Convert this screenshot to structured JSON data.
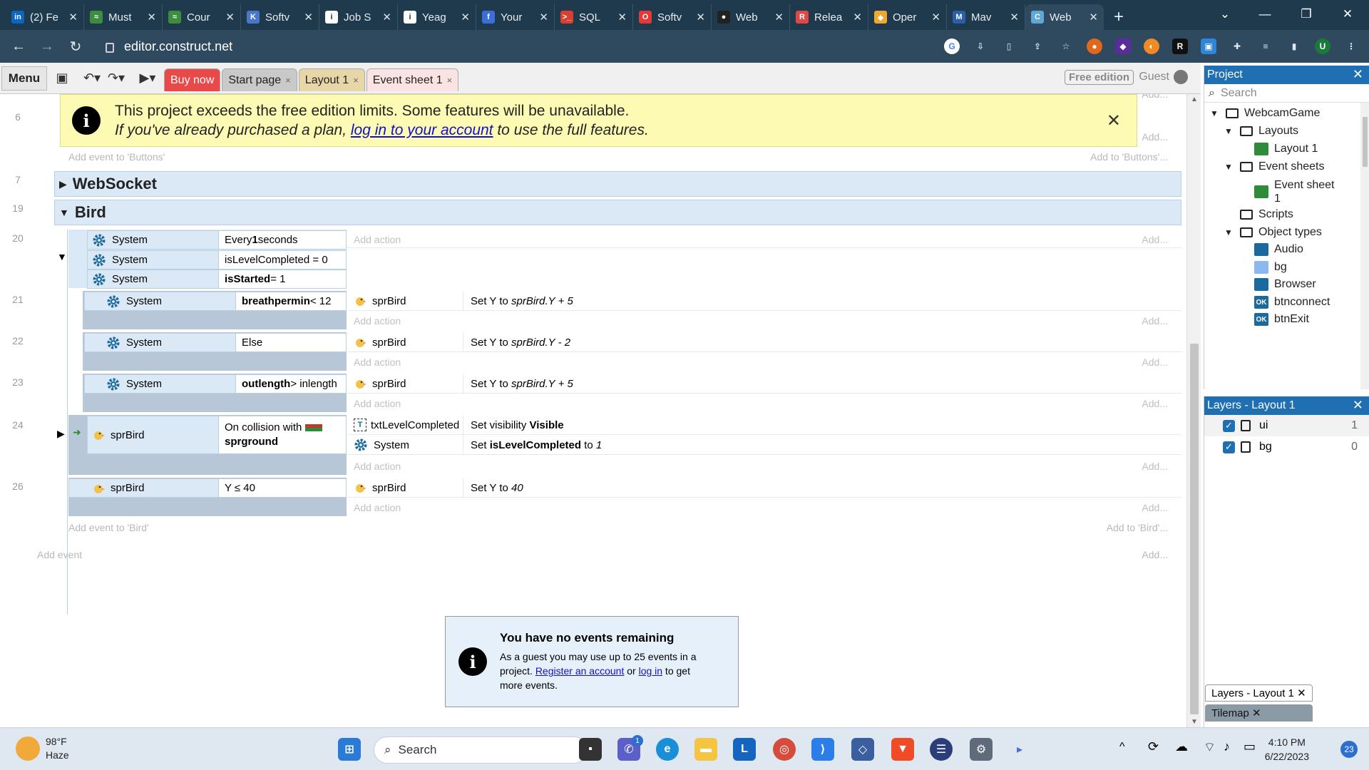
{
  "browser": {
    "tabs": [
      {
        "label": "(2) Fe",
        "icon": "linkedin-icon",
        "color": "#0a66c2",
        "glyph": "in"
      },
      {
        "label": "Must",
        "icon": "mustache-icon",
        "color": "#3c8d40",
        "glyph": "≈"
      },
      {
        "label": "Cour",
        "icon": "mustache-icon",
        "color": "#3c8d40",
        "glyph": "≈"
      },
      {
        "label": "Softv",
        "icon": "k-icon",
        "color": "#4a78c8",
        "glyph": "K"
      },
      {
        "label": "Job S",
        "icon": "info-icon",
        "color": "#ffffff",
        "glyph": "i"
      },
      {
        "label": "Yeag",
        "icon": "info-icon",
        "color": "#ffffff",
        "glyph": "i"
      },
      {
        "label": "Your",
        "icon": "upwork-icon",
        "color": "#3b6ed8",
        "glyph": "f"
      },
      {
        "label": "SQL",
        "icon": "terminal-icon",
        "color": "#d94032",
        "glyph": ">_"
      },
      {
        "label": "Softv",
        "icon": "oracle-icon",
        "color": "#e53935",
        "glyph": "O"
      },
      {
        "label": "Web",
        "icon": "github-icon",
        "color": "#222222",
        "glyph": "●"
      },
      {
        "label": "Relea",
        "icon": "release-icon",
        "color": "#e04747",
        "glyph": "R"
      },
      {
        "label": "Oper",
        "icon": "diamond-icon",
        "color": "#f0a830",
        "glyph": "◆"
      },
      {
        "label": "Mav",
        "icon": "maven-icon",
        "color": "#2b5fa8",
        "glyph": "M"
      },
      {
        "label": "Web",
        "icon": "construct-icon",
        "color": "#5fa8d8",
        "glyph": "C"
      }
    ],
    "url": "editor.construct.net",
    "new_tab": "+"
  },
  "editor": {
    "menu": "Menu",
    "tabs": [
      {
        "label": "Buy now",
        "bg": "#e84a4a",
        "fg": "#ffffff",
        "close": ""
      },
      {
        "label": "Start page",
        "bg": "#c9c9c9",
        "fg": "#222222",
        "close": "×"
      },
      {
        "label": "Layout 1",
        "bg": "#e7d6a8",
        "fg": "#222222",
        "close": "×"
      },
      {
        "label": "Event sheet 1",
        "bg": "#fbe3e3",
        "fg": "#222222",
        "close": "×"
      }
    ],
    "free_edition": "Free edition",
    "guest": "Guest"
  },
  "banner": {
    "line1": "This project exceeds the free edition limits. Some features will be unavailable.",
    "line2_pre": "If you've already purchased a plan, ",
    "line2_link": "log in to your account",
    "line2_post": " to use the full features."
  },
  "sheet": {
    "add_action": "Add action",
    "add_short": "Add...",
    "add_event_buttons": "Add event to 'Buttons'",
    "add_to_buttons": "Add to 'Buttons'...",
    "add_event_bird": "Add event to 'Bird'",
    "add_to_bird": "Add to 'Bird'...",
    "add_event": "Add event",
    "line_numbers": [
      "6",
      "7",
      "19",
      "20",
      "21",
      "22",
      "23",
      "24",
      "26"
    ],
    "groups": [
      {
        "name": "WebSocket",
        "tri": "▶"
      },
      {
        "name": "Bird",
        "tri": "▼"
      }
    ],
    "event20": {
      "conds": [
        {
          "obj": "System",
          "pre": "Every ",
          "bold": "1",
          "post": " seconds"
        },
        {
          "obj": "System",
          "pre": "isLevelCompleted = 0",
          "bold": "",
          "post": ""
        },
        {
          "obj": "System",
          "pre": "",
          "bold": "isStarted",
          "post": " = 1"
        }
      ]
    },
    "event21": {
      "obj": "System",
      "bold": "breathpermin",
      "post": " < 12",
      "aobj": "sprBird",
      "atext_pre": "Set Y to ",
      "atext_em": "sprBird.Y + 5"
    },
    "event22": {
      "obj": "System",
      "bold": "",
      "post": "Else",
      "aobj": "sprBird",
      "atext_pre": "Set Y to ",
      "atext_em": "sprBird.Y - 2"
    },
    "event23": {
      "obj": "System",
      "bold": "outlength",
      "post": " > inlength",
      "aobj": "sprBird",
      "atext_pre": "Set Y to ",
      "atext_em": "sprBird.Y + 5"
    },
    "event24": {
      "obj": "sprBird",
      "cond_line1": "On collision with",
      "cond_line2": "sprground",
      "actions": [
        {
          "obj": "txtLevelCompleted",
          "pre": "Set visibility ",
          "bold": "Visible",
          "post": "",
          "em": ""
        },
        {
          "obj": "System",
          "pre": "Set ",
          "bold": "isLevelCompleted",
          "post": " to ",
          "em": "1"
        }
      ]
    },
    "event26": {
      "obj": "sprBird",
      "cond": "Y ≤ 40",
      "aobj": "sprBird",
      "atext_pre": "Set Y to ",
      "atext_em": "40"
    }
  },
  "notice": {
    "title": "You have no events remaining",
    "pre": "As a guest you may use up to 25 events in a project. ",
    "link1": "Register an account",
    "mid": " or ",
    "link2": "log in",
    "post": " to get more events."
  },
  "project": {
    "title": "Project",
    "search": "Search",
    "tree": [
      {
        "label": "WebcamGame",
        "kind": "folder",
        "tri": "▼"
      },
      {
        "label": "Layouts",
        "kind": "folder",
        "tri": "▼"
      },
      {
        "label": "Layout 1",
        "kind": "layout-icon",
        "tri": ""
      },
      {
        "label": "Event sheets",
        "kind": "folder",
        "tri": "▼"
      },
      {
        "label": "Event sheet 1",
        "kind": "eventsheet-icon",
        "tri": ""
      },
      {
        "label": "Scripts",
        "kind": "folder",
        "tri": ""
      },
      {
        "label": "Object types",
        "kind": "folder",
        "tri": "▼"
      },
      {
        "label": "Audio",
        "kind": "audio-icon",
        "tri": ""
      },
      {
        "label": "bg",
        "kind": "sprite-icon",
        "tri": ""
      },
      {
        "label": "Browser",
        "kind": "browser-icon",
        "tri": ""
      },
      {
        "label": "btnconnect",
        "kind": "button-icon",
        "tri": ""
      },
      {
        "label": "btnExit",
        "kind": "button-icon",
        "tri": ""
      }
    ]
  },
  "layers": {
    "title": "Layers - Layout 1",
    "rows": [
      {
        "name": "ui",
        "num": "1"
      },
      {
        "name": "bg",
        "num": "0"
      }
    ],
    "bottom_tabs": [
      "Layers - Layout 1",
      "Tilemap"
    ]
  },
  "taskbar": {
    "weather_temp": "98°F",
    "weather_desc": "Haze",
    "search": "Search",
    "time": "4:10 PM",
    "date": "6/22/2023",
    "badge": "23",
    "chat_badge": "1"
  }
}
